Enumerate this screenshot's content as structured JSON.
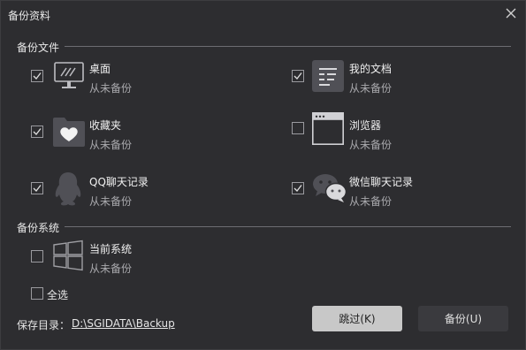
{
  "window": {
    "title": "备份资料"
  },
  "sections": {
    "files_label": "备份文件",
    "system_label": "备份系统"
  },
  "items": {
    "desktop": {
      "title": "桌面",
      "status": "从未备份",
      "checked": true,
      "icon": "desktop-monitor-icon"
    },
    "documents": {
      "title": "我的文档",
      "status": "从未备份",
      "checked": true,
      "icon": "documents-icon"
    },
    "favorites": {
      "title": "收藏夹",
      "status": "从未备份",
      "checked": true,
      "icon": "favorites-folder-heart-icon"
    },
    "browser": {
      "title": "浏览器",
      "status": "从未备份",
      "checked": false,
      "icon": "browser-window-icon"
    },
    "qq": {
      "title": "QQ聊天记录",
      "status": "从未备份",
      "checked": true,
      "icon": "qq-penguin-icon"
    },
    "wechat": {
      "title": "微信聊天记录",
      "status": "从未备份",
      "checked": true,
      "icon": "wechat-icon"
    },
    "system": {
      "title": "当前系统",
      "status": "从未备份",
      "checked": false,
      "icon": "windows-logo-icon"
    }
  },
  "select_all": {
    "label": "全选",
    "checked": false
  },
  "save": {
    "label": "保存目录：",
    "path": "D:\\SGIDATA\\Backup"
  },
  "buttons": {
    "skip": "跳过(K)",
    "backup": "备份(U)"
  },
  "colors": {
    "background": "#2d2d30",
    "skip_button": "#c8c8c8",
    "backup_button": "#3a3a3e"
  }
}
